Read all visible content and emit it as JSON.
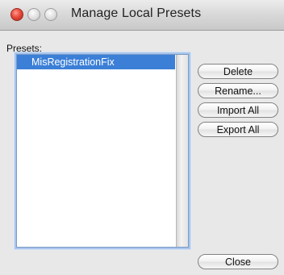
{
  "window": {
    "title": "Manage Local Presets"
  },
  "presets_label": "Presets:",
  "presets": [
    {
      "name": "MisRegistrationFix",
      "selected": true
    }
  ],
  "buttons": {
    "delete": "Delete",
    "rename": "Rename...",
    "import_all": "Import All",
    "export_all": "Export All",
    "close": "Close"
  },
  "colors": {
    "selection": "#3b7fd7",
    "close_light": "#e84b3c"
  }
}
